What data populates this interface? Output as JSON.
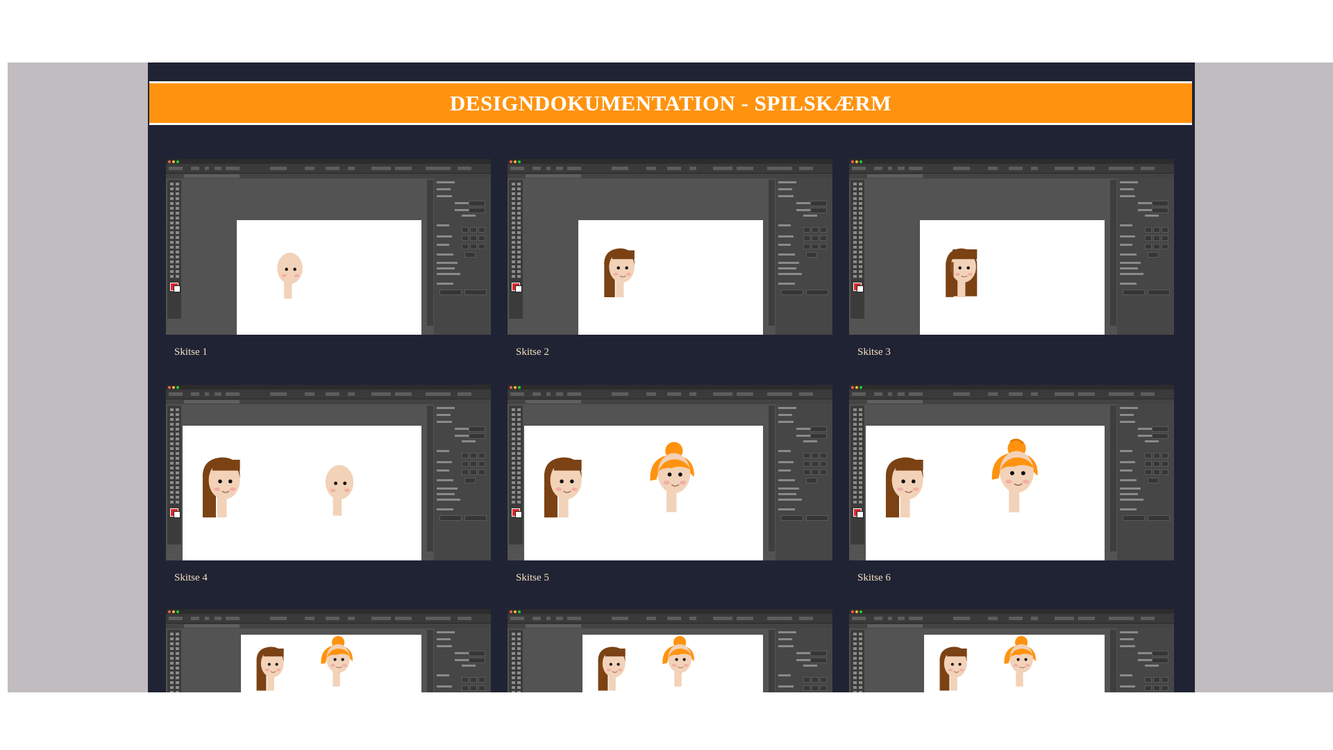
{
  "header": {
    "title": "DESIGNDOKUMENTATION - SPILSKÆRM"
  },
  "sketches": [
    {
      "caption": "Skitse 1",
      "image": "illustrator-sketch-bald-head"
    },
    {
      "caption": "Skitse 2",
      "image": "illustrator-sketch-brown-bob-hair"
    },
    {
      "caption": "Skitse 3",
      "image": "illustrator-sketch-brown-long-hair"
    },
    {
      "caption": "Skitse 4",
      "image": "illustrator-sketch-brown-hair-and-bald-head"
    },
    {
      "caption": "Skitse 5",
      "image": "illustrator-sketch-brown-hair-and-orange-bun"
    },
    {
      "caption": "Skitse 6",
      "image": "illustrator-sketch-brown-hair-and-orange-bun-refined"
    },
    {
      "caption": "",
      "image": "illustrator-sketch-two-characters"
    },
    {
      "caption": "",
      "image": "illustrator-sketch-two-characters"
    },
    {
      "caption": "",
      "image": "illustrator-sketch-two-characters"
    }
  ],
  "colors": {
    "page_bg": "#1f2333",
    "banner": "#ff930f",
    "caption": "#f5dcc4",
    "skin": "#f2d2b8",
    "brown_hair": "#7b4214",
    "orange_hair": "#ff930f",
    "blush": "#f4a2a2",
    "illustrator_ui": "#535353"
  }
}
